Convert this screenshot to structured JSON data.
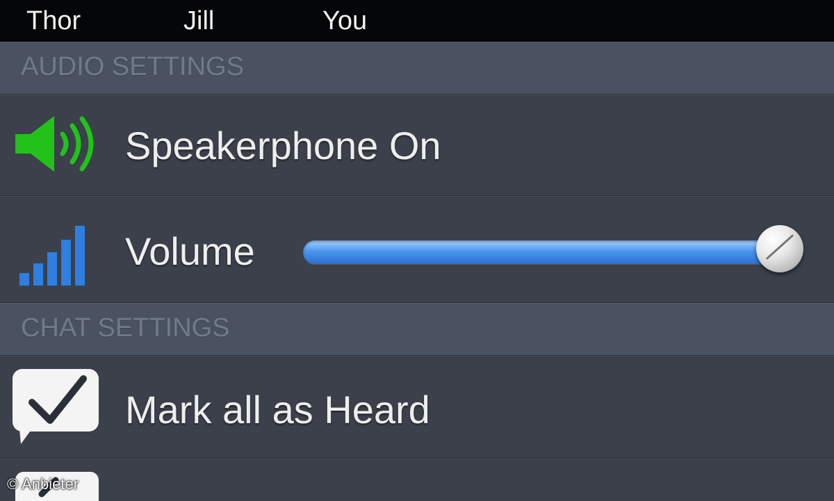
{
  "contacts": [
    "Thor",
    "Jill",
    "You"
  ],
  "audio_settings": {
    "title": "AUDIO SETTINGS",
    "speakerphone_label": "Speakerphone On",
    "volume_label": "Volume",
    "volume_level": 1.0,
    "speaker_icon": "speaker-icon",
    "volume_icon": "signal-bars-icon",
    "accent_green": "#22c21a",
    "accent_blue": "#2f7fe0"
  },
  "chat_settings": {
    "title": "CHAT SETTINGS",
    "mark_heard_label": "Mark all as Heard",
    "mark_heard_icon": "checkmark-bubble-icon"
  },
  "watermark": "© Anbieter"
}
